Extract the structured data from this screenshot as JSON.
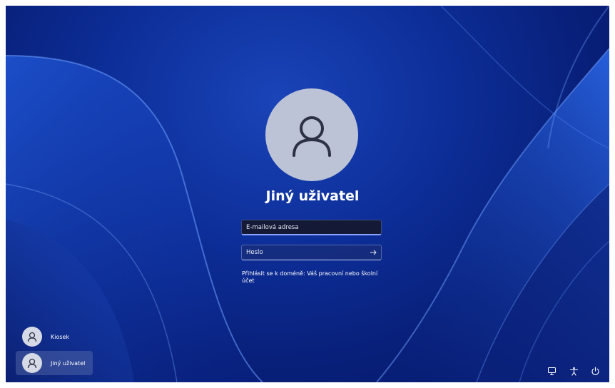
{
  "login": {
    "user_name": "Jiný uživatel",
    "email_placeholder": "E-mailová adresa",
    "password_placeholder": "Heslo",
    "domain_text": "Přihlásit se k doméně: Váš pracovní nebo školní účet"
  },
  "users": [
    {
      "name": "Kiosek",
      "selected": false
    },
    {
      "name": "Jiný uživatel",
      "selected": true
    }
  ],
  "icons": {
    "submit": "arrow-right-icon",
    "network": "network-icon",
    "accessibility": "accessibility-icon",
    "power": "power-icon"
  },
  "colors": {
    "background_accent": "#0d2f9a",
    "avatar": "#bcc3d6"
  }
}
